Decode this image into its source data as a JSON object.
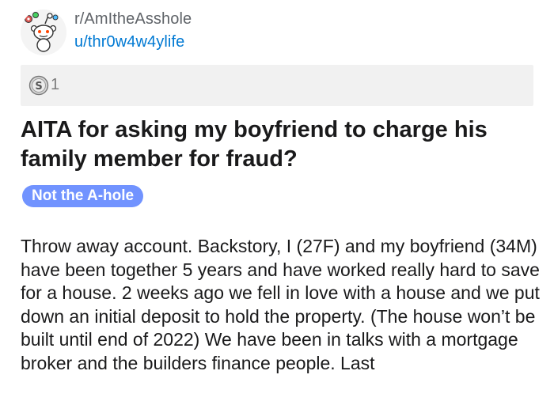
{
  "post": {
    "subreddit": "r/AmItheAsshole",
    "author": "u/thr0w4w4ylife",
    "avatar_icon": "reddit-snoo-avatar-icon",
    "awards": {
      "icon": "silver-award-icon",
      "count": "1"
    },
    "title": "AITA for asking my boyfriend to charge his family member for fraud?",
    "flair": {
      "label": "Not the A-hole",
      "color": "#7193ff"
    },
    "body": "Throw away account. Backstory, I (27F) and my boyfriend (34M) have been together 5 years and have worked really hard to save for a house. 2 weeks ago we fell in love with a house and we put down an initial deposit to hold the property. (The house won’t be built until end of 2022) We have been in talks with a mortgage broker and the builders finance people. Last"
  },
  "colors": {
    "link_blue": "#0079d3",
    "meta_gray": "#5f6368",
    "award_bar_bg": "#f1f1f1",
    "text": "#1a1a1b"
  }
}
